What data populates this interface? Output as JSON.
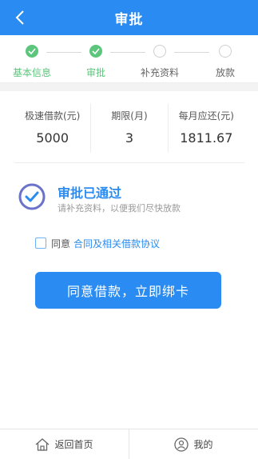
{
  "header": {
    "title": "审批"
  },
  "steps": [
    {
      "label": "基本信息",
      "status": "done"
    },
    {
      "label": "审批",
      "status": "done"
    },
    {
      "label": "补充资料",
      "status": "todo"
    },
    {
      "label": "放款",
      "status": "todo"
    }
  ],
  "stats": [
    {
      "label": "极速借款(元)",
      "value": "5000"
    },
    {
      "label": "期限(月)",
      "value": "3"
    },
    {
      "label": "每月应还(元)",
      "value": "1811.67"
    }
  ],
  "result": {
    "title": "审批已通过",
    "subtitle": "请补充资料，以便我们尽快放款"
  },
  "agreement": {
    "prefix": "同意",
    "link": "合同及相关借款协议",
    "checked": false
  },
  "cta": {
    "label": "同意借款，立即绑卡"
  },
  "tabbar": [
    {
      "label": "返回首页",
      "icon": "home-icon"
    },
    {
      "label": "我的",
      "icon": "user-icon"
    }
  ],
  "colors": {
    "primary": "#2a8cf2",
    "success": "#5cc67c"
  }
}
